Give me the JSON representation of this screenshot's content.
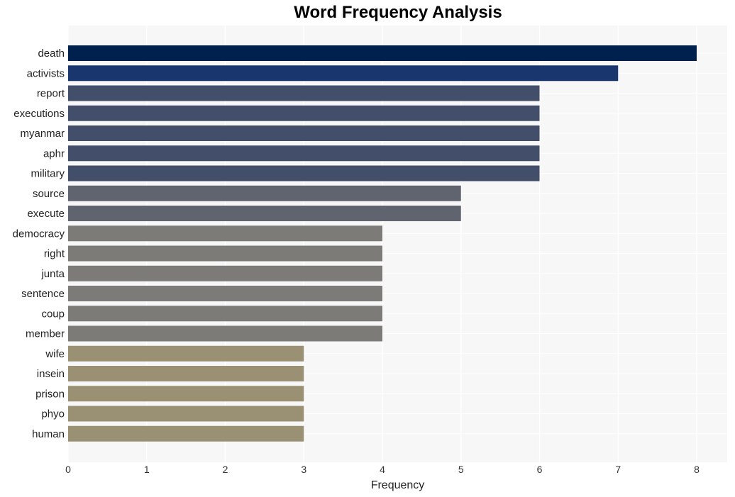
{
  "chart_data": {
    "type": "bar",
    "orientation": "horizontal",
    "title": "Word Frequency Analysis",
    "xlabel": "Frequency",
    "ylabel": "",
    "xlim": [
      0,
      8.4
    ],
    "xticks": [
      0,
      1,
      2,
      3,
      4,
      5,
      6,
      7,
      8
    ],
    "grid": true,
    "legend": "none",
    "categories": [
      "death",
      "activists",
      "report",
      "executions",
      "myanmar",
      "aphr",
      "military",
      "source",
      "execute",
      "democracy",
      "right",
      "junta",
      "sentence",
      "coup",
      "member",
      "wife",
      "insein",
      "prison",
      "phyo",
      "human"
    ],
    "values": [
      8,
      7,
      6,
      6,
      6,
      6,
      6,
      5,
      5,
      4,
      4,
      4,
      4,
      4,
      4,
      3,
      3,
      3,
      3,
      3
    ],
    "colors": {
      "8": "#00204e",
      "7": "#1a366e",
      "6": "#434e6b",
      "5": "#60646f",
      "4": "#7c7b78",
      "3": "#9a9175"
    },
    "plot_background": "#f7f7f7",
    "grid_color": "#ffffff"
  }
}
